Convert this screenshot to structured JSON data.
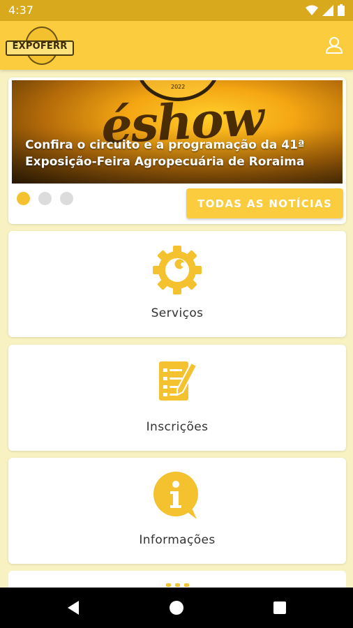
{
  "status_bar": {
    "time": "4:37"
  },
  "app_bar": {
    "logo_text": "EXPOFERR"
  },
  "news": {
    "banner_title": "éshow",
    "banner_year": "2022",
    "caption": "Confira o circuito e a programação da 41ª Exposição-Feira Agropecuária de Roraima",
    "all_news_label": "TODAS AS NOTÍCIAS",
    "slide_count": 3,
    "active_slide": 1
  },
  "menu": [
    {
      "label": "Serviços",
      "icon": "gear-wrench-icon"
    },
    {
      "label": "Inscrições",
      "icon": "checklist-pencil-icon"
    },
    {
      "label": "Informações",
      "icon": "info-bubble-icon"
    }
  ],
  "colors": {
    "accent": "#fbcd3e",
    "status_bar": "#d9a91d",
    "background": "#f8f2c2",
    "icon": "#f5c22f"
  }
}
